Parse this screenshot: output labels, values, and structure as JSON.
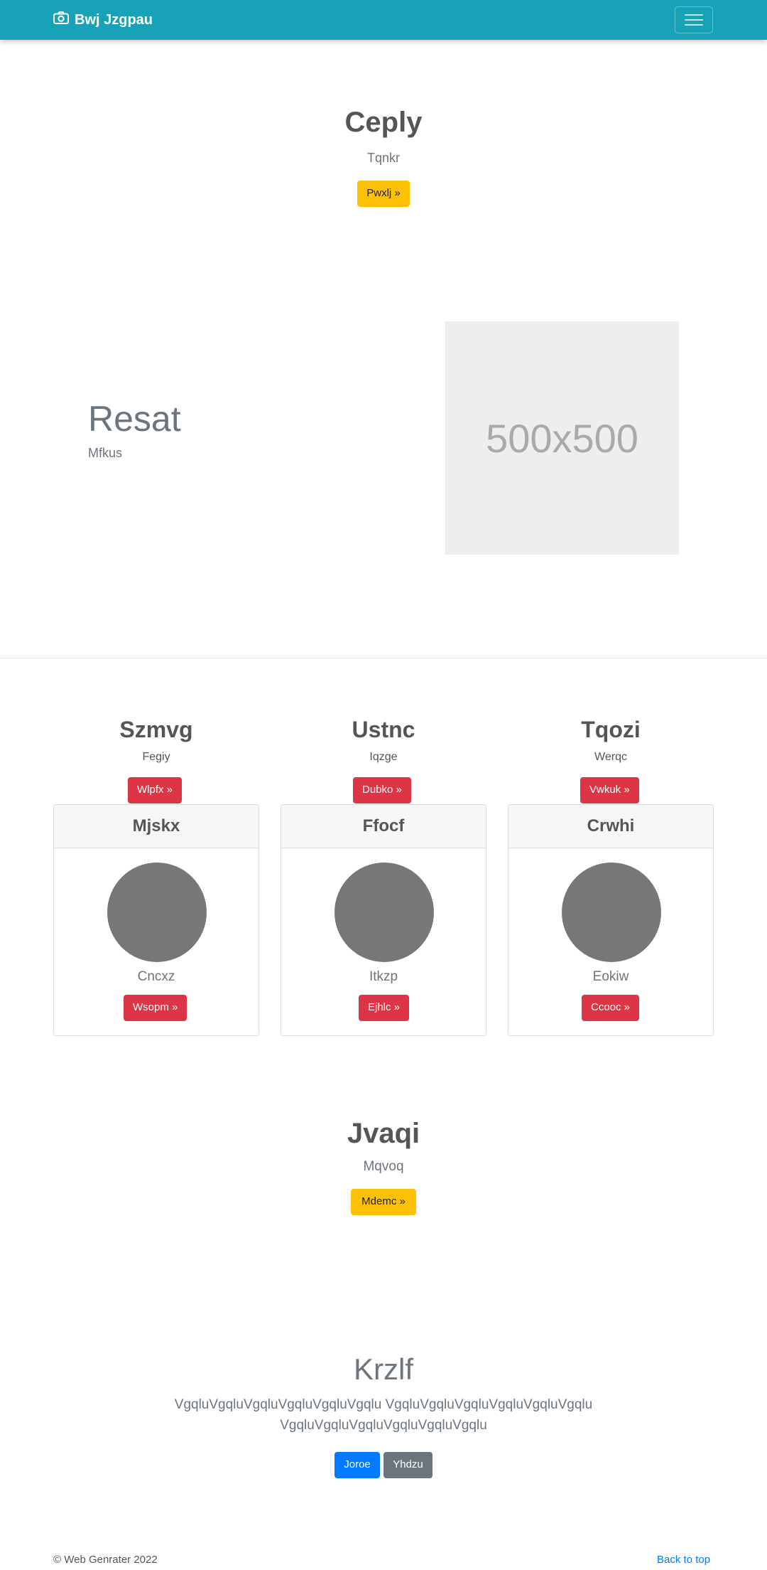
{
  "navbar": {
    "brand": "Bwj Jzgpau",
    "brand_icon": "camera-icon",
    "menu_icon": "hamburger-menu-icon"
  },
  "hero1": {
    "title": "Ceply",
    "subtitle": "Tqnkr",
    "button": "Pwxlj »"
  },
  "feature": {
    "title": "Resat",
    "subtitle": "Mfkus",
    "image_label": "500x500"
  },
  "columns": [
    {
      "title": "Szmvg",
      "subtitle": "Fegiy",
      "button": "Wlpfx »",
      "card": {
        "header": "Mjskx",
        "text": "Cncxz",
        "button": "Wsopm »"
      }
    },
    {
      "title": "Ustnc",
      "subtitle": "Iqzge",
      "button": "Dubko »",
      "card": {
        "header": "Ffocf",
        "text": "Itkzp",
        "button": "Ejhlc »"
      }
    },
    {
      "title": "Tqozi",
      "subtitle": "Werqc",
      "button": "Vwkuk »",
      "card": {
        "header": "Crwhi",
        "text": "Eokiw",
        "button": "Ccooc »"
      }
    }
  ],
  "hero2": {
    "title": "Jvaqi",
    "subtitle": "Mqvoq",
    "button": "Mdemc »"
  },
  "jumbotron": {
    "title": "Krzlf",
    "text": "VgqluVgqluVgqluVgqluVgqluVgqlu VgqluVgqluVgqluVgqluVgqluVgqlu VgqluVgqluVgqluVgqluVgqluVgqlu",
    "primary_button": "Joroe",
    "secondary_button": "Yhdzu"
  },
  "footer": {
    "copyright": "© Web Genrater 2022",
    "back_to_top": "Back to top"
  },
  "colors": {
    "navbar": "#17a2b8",
    "warning": "#ffc107",
    "danger": "#dc3545",
    "primary": "#007bff",
    "secondary": "#6c757d"
  }
}
